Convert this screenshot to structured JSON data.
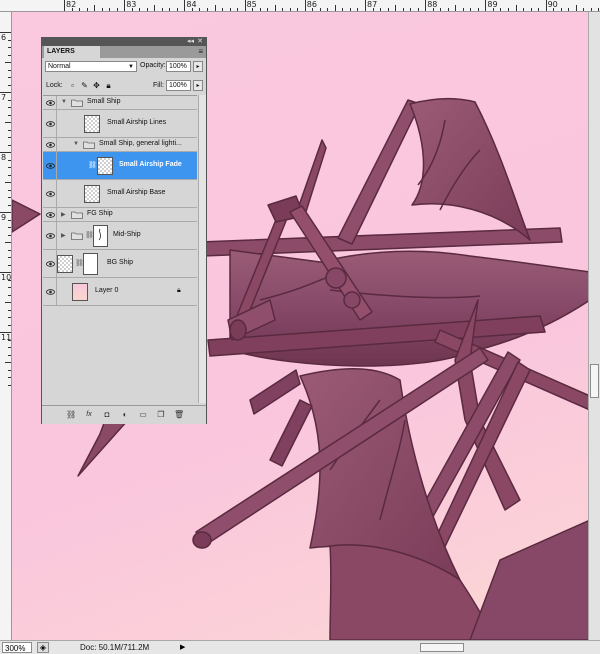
{
  "ruler": {
    "top_labels": [
      "82",
      "83",
      "84",
      "85",
      "86",
      "87",
      "88",
      "89",
      "90"
    ],
    "left_labels": [
      "6",
      "7",
      "8",
      "9",
      "10",
      "11"
    ]
  },
  "status_bar": {
    "zoom": "300%",
    "doc_info": "Doc: 50.1M/711.2M"
  },
  "layers_panel": {
    "tab_label": "LAYERS",
    "blend_mode": "Normal",
    "opacity_label": "Opacity:",
    "opacity_value": "100%",
    "lock_label": "Lock:",
    "fill_label": "Fill:",
    "fill_value": "100%",
    "layers": [
      {
        "name": "Small Ship",
        "type": "group",
        "expanded": true,
        "indent": 0,
        "selected": false
      },
      {
        "name": "Small Airship Lines",
        "type": "layer",
        "indent": 1,
        "selected": false
      },
      {
        "name": "Small Ship, general lighti...",
        "type": "group",
        "expanded": true,
        "indent": 1,
        "selected": false
      },
      {
        "name": "Small Airship Fade",
        "type": "layer",
        "indent": 2,
        "selected": true
      },
      {
        "name": "Small Airship Base",
        "type": "layer",
        "indent": 1,
        "selected": false
      },
      {
        "name": "FG Ship",
        "type": "group",
        "expanded": false,
        "indent": 0,
        "selected": false
      },
      {
        "name": "Mid-Ship",
        "type": "group-mask",
        "expanded": false,
        "indent": 0,
        "selected": false
      },
      {
        "name": "BG Ship",
        "type": "layer-mask",
        "indent": 0,
        "selected": false
      },
      {
        "name": "Layer 0",
        "type": "background",
        "indent": 0,
        "selected": false,
        "locked": true
      }
    ],
    "footer_icons": [
      "link-layers-icon",
      "fx-icon",
      "add-mask-icon",
      "adjustment-layer-icon",
      "new-group-icon",
      "new-layer-icon",
      "trash-icon"
    ]
  },
  "colors": {
    "canvas_pink": "#fac8df",
    "ship_maroon": "#7a3c55",
    "selection_blue": "#3d95f0"
  }
}
